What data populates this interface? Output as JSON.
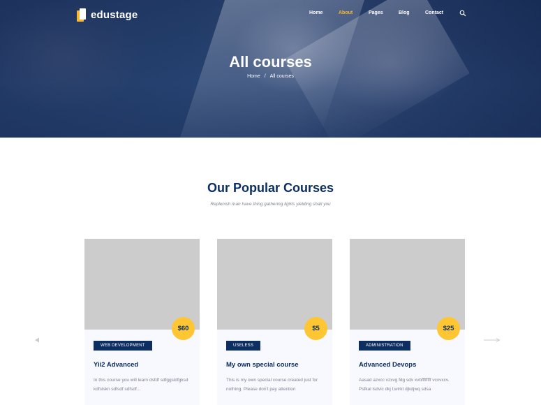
{
  "brand": {
    "name": "edustage",
    "accent": "#f7b731",
    "navy": "#0c2e60"
  },
  "nav": {
    "items": [
      {
        "label": "Home",
        "active": false
      },
      {
        "label": "About",
        "active": true
      },
      {
        "label": "Pages",
        "active": false
      },
      {
        "label": "Blog",
        "active": false
      },
      {
        "label": "Contact",
        "active": false
      }
    ],
    "search_icon": "search-icon"
  },
  "hero": {
    "title": "All courses",
    "breadcrumb": {
      "home": "Home",
      "separator": "/",
      "current": "All courses"
    }
  },
  "section": {
    "title": "Our Popular Courses",
    "subtitle": "Replenish man have thing gathering lights yielding shall you"
  },
  "carousel": {
    "prev_icon": "arrow-left-icon",
    "next_icon": "arrow-right-icon"
  },
  "courses": [
    {
      "price": "$60",
      "category": "WEB DEVELOPMENT",
      "title": "Yii2 Advanced",
      "description": "In this course you will learn dsfdf sdfggsldfgksd kdfslskn sdfsdf sdfsdf..."
    },
    {
      "price": "$5",
      "category": "USELESS",
      "title": "My own special course",
      "description": "This is my own special course created just for nothing. Please don't pay attention"
    },
    {
      "price": "$25",
      "category": "ADMINISTRATION",
      "title": "Advanced Devops",
      "description": "Aasad azxcc vzxvg fdg sdx xvbffffffff vcxvxcv. Psfkal lsdvic dkj l;wirkt djkdjwq sdsa"
    }
  ]
}
